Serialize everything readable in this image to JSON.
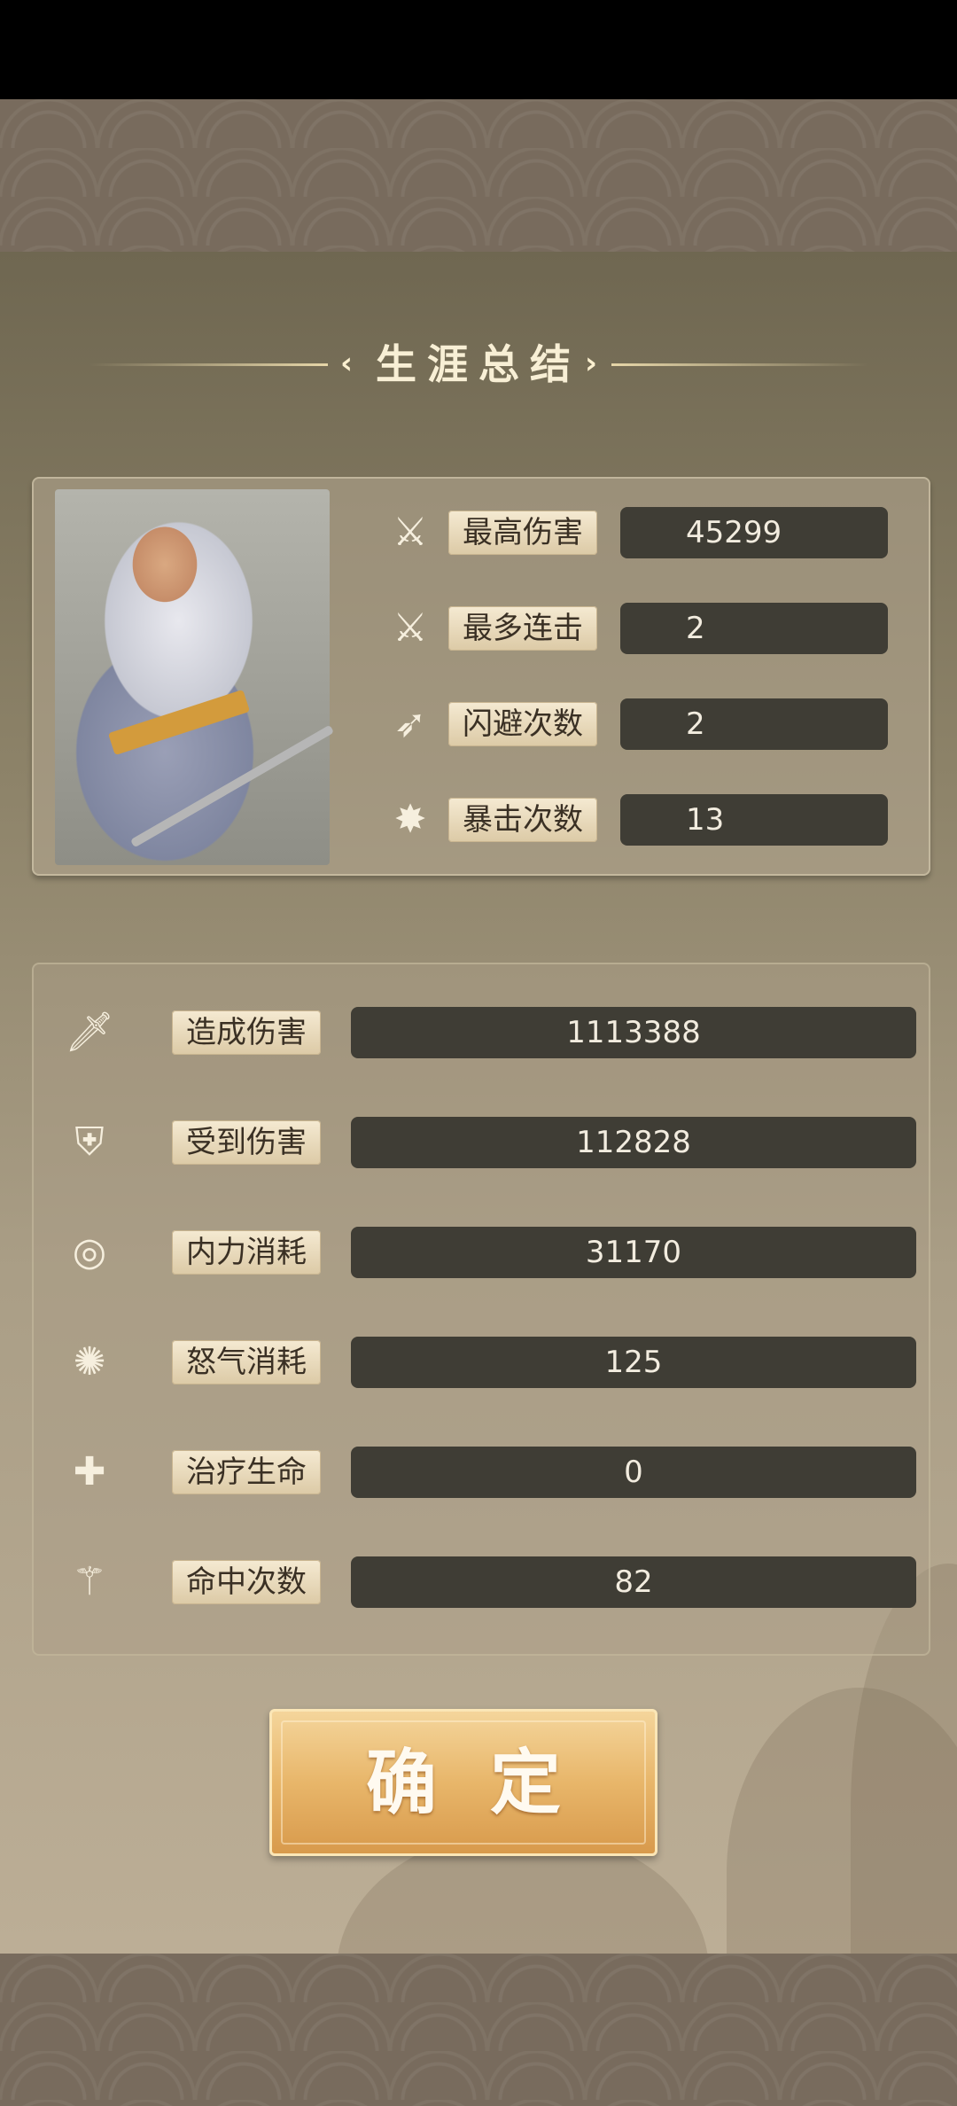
{
  "title": "生涯总结",
  "title_left_chevron": "‹",
  "title_right_chevron": "›",
  "hero_stats": [
    {
      "icon": "sword-burst-icon",
      "glyph": "⚔",
      "label": "最高伤害",
      "value": "45299"
    },
    {
      "icon": "crossed-swords-icon",
      "glyph": "⚔",
      "label": "最多连击",
      "value": "2"
    },
    {
      "icon": "dodge-boot-icon",
      "glyph": "➶",
      "label": "闪避次数",
      "value": "2"
    },
    {
      "icon": "critical-star-icon",
      "glyph": "✸",
      "label": "暴击次数",
      "value": "13"
    }
  ],
  "career_stats": [
    {
      "icon": "sword-damage-icon",
      "glyph": "🗡",
      "label": "造成伤害",
      "value": "1113388"
    },
    {
      "icon": "shield-icon",
      "glyph": "⛨",
      "label": "受到伤害",
      "value": "112828"
    },
    {
      "icon": "inner-force-icon",
      "glyph": "◎",
      "label": "内力消耗",
      "value": "31170"
    },
    {
      "icon": "rage-burst-icon",
      "glyph": "✺",
      "label": "怒气消耗",
      "value": "125"
    },
    {
      "icon": "heal-cross-icon",
      "glyph": "✚",
      "label": "治疗生命",
      "value": "0"
    },
    {
      "icon": "hit-sword-icon",
      "glyph": "⚚",
      "label": "命中次数",
      "value": "82"
    }
  ],
  "confirm_label": "确定"
}
